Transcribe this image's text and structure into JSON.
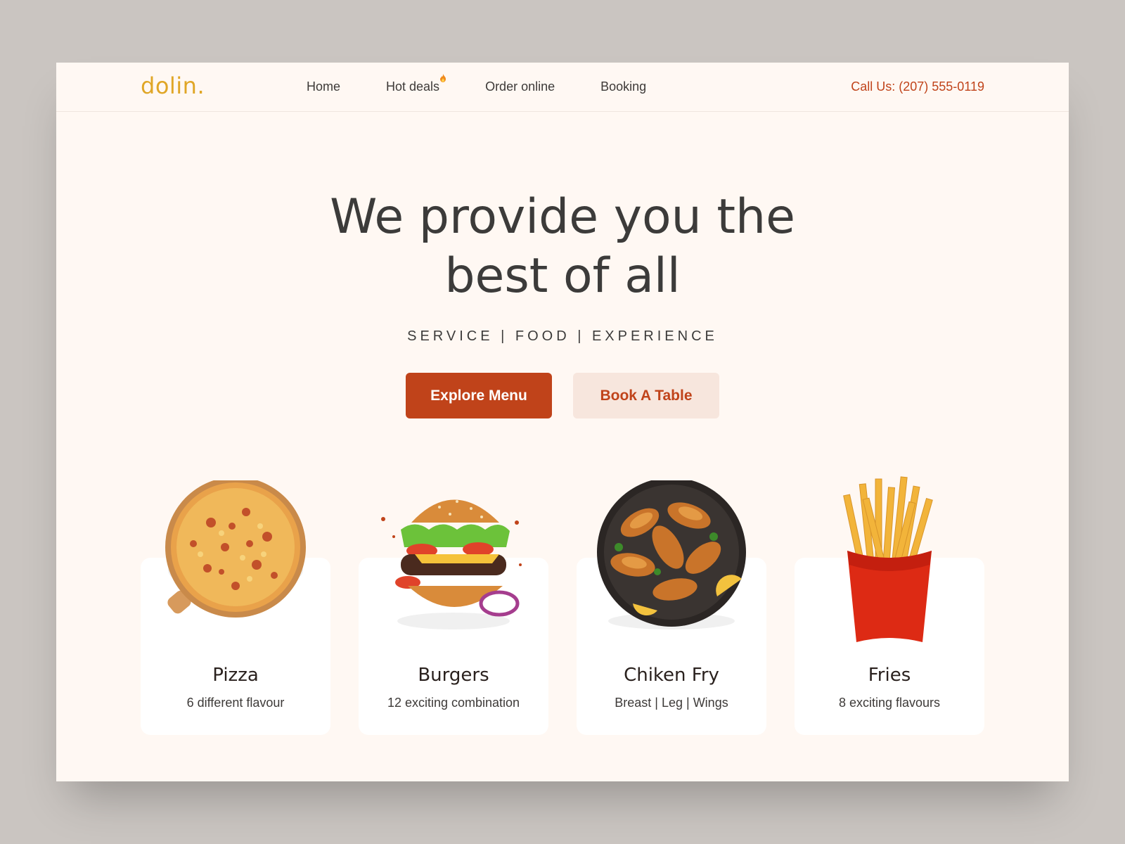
{
  "brand": {
    "logo": "dolin."
  },
  "nav": {
    "links": [
      "Home",
      "Hot deals",
      "Order online",
      "Booking"
    ],
    "call": "Call Us: (207) 555-0119"
  },
  "hero": {
    "title_line1": "We provide you the",
    "title_line2": "best of all",
    "tagline": "SERVICE | FOOD | EXPERIENCE",
    "primary_button": "Explore Menu",
    "secondary_button": "Book A Table"
  },
  "cards": [
    {
      "title": "Pizza",
      "subtitle": "6 different flavour",
      "icon": "pizza-icon"
    },
    {
      "title": "Burgers",
      "subtitle": "12 exciting combination",
      "icon": "burger-icon"
    },
    {
      "title": "Chiken Fry",
      "subtitle": "Breast | Leg | Wings",
      "icon": "fried-chicken-icon"
    },
    {
      "title": "Fries",
      "subtitle": "8 exciting flavours",
      "icon": "fries-icon"
    }
  ],
  "colors": {
    "accent": "#c0431a",
    "logo": "#e0a626",
    "background": "#fff8f3",
    "outer": "#cac5c1"
  }
}
